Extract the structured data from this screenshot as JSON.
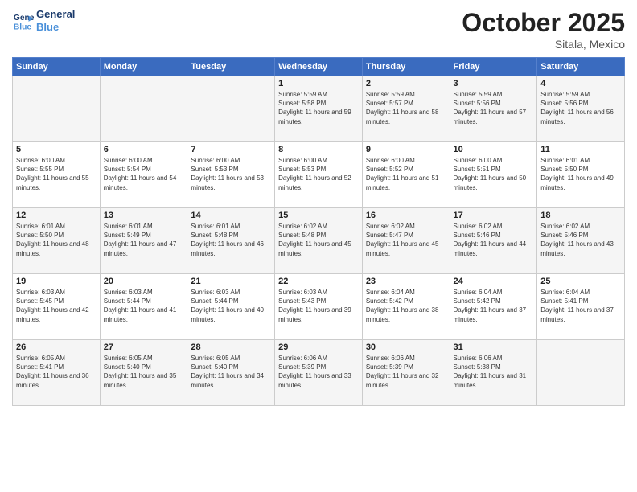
{
  "header": {
    "logo_line1": "General",
    "logo_line2": "Blue",
    "month": "October 2025",
    "location": "Sitala, Mexico"
  },
  "weekdays": [
    "Sunday",
    "Monday",
    "Tuesday",
    "Wednesday",
    "Thursday",
    "Friday",
    "Saturday"
  ],
  "weeks": [
    [
      {
        "day": "",
        "info": ""
      },
      {
        "day": "",
        "info": ""
      },
      {
        "day": "",
        "info": ""
      },
      {
        "day": "1",
        "info": "Sunrise: 5:59 AM\nSunset: 5:58 PM\nDaylight: 11 hours and 59 minutes."
      },
      {
        "day": "2",
        "info": "Sunrise: 5:59 AM\nSunset: 5:57 PM\nDaylight: 11 hours and 58 minutes."
      },
      {
        "day": "3",
        "info": "Sunrise: 5:59 AM\nSunset: 5:56 PM\nDaylight: 11 hours and 57 minutes."
      },
      {
        "day": "4",
        "info": "Sunrise: 5:59 AM\nSunset: 5:56 PM\nDaylight: 11 hours and 56 minutes."
      }
    ],
    [
      {
        "day": "5",
        "info": "Sunrise: 6:00 AM\nSunset: 5:55 PM\nDaylight: 11 hours and 55 minutes."
      },
      {
        "day": "6",
        "info": "Sunrise: 6:00 AM\nSunset: 5:54 PM\nDaylight: 11 hours and 54 minutes."
      },
      {
        "day": "7",
        "info": "Sunrise: 6:00 AM\nSunset: 5:53 PM\nDaylight: 11 hours and 53 minutes."
      },
      {
        "day": "8",
        "info": "Sunrise: 6:00 AM\nSunset: 5:53 PM\nDaylight: 11 hours and 52 minutes."
      },
      {
        "day": "9",
        "info": "Sunrise: 6:00 AM\nSunset: 5:52 PM\nDaylight: 11 hours and 51 minutes."
      },
      {
        "day": "10",
        "info": "Sunrise: 6:00 AM\nSunset: 5:51 PM\nDaylight: 11 hours and 50 minutes."
      },
      {
        "day": "11",
        "info": "Sunrise: 6:01 AM\nSunset: 5:50 PM\nDaylight: 11 hours and 49 minutes."
      }
    ],
    [
      {
        "day": "12",
        "info": "Sunrise: 6:01 AM\nSunset: 5:50 PM\nDaylight: 11 hours and 48 minutes."
      },
      {
        "day": "13",
        "info": "Sunrise: 6:01 AM\nSunset: 5:49 PM\nDaylight: 11 hours and 47 minutes."
      },
      {
        "day": "14",
        "info": "Sunrise: 6:01 AM\nSunset: 5:48 PM\nDaylight: 11 hours and 46 minutes."
      },
      {
        "day": "15",
        "info": "Sunrise: 6:02 AM\nSunset: 5:48 PM\nDaylight: 11 hours and 45 minutes."
      },
      {
        "day": "16",
        "info": "Sunrise: 6:02 AM\nSunset: 5:47 PM\nDaylight: 11 hours and 45 minutes."
      },
      {
        "day": "17",
        "info": "Sunrise: 6:02 AM\nSunset: 5:46 PM\nDaylight: 11 hours and 44 minutes."
      },
      {
        "day": "18",
        "info": "Sunrise: 6:02 AM\nSunset: 5:46 PM\nDaylight: 11 hours and 43 minutes."
      }
    ],
    [
      {
        "day": "19",
        "info": "Sunrise: 6:03 AM\nSunset: 5:45 PM\nDaylight: 11 hours and 42 minutes."
      },
      {
        "day": "20",
        "info": "Sunrise: 6:03 AM\nSunset: 5:44 PM\nDaylight: 11 hours and 41 minutes."
      },
      {
        "day": "21",
        "info": "Sunrise: 6:03 AM\nSunset: 5:44 PM\nDaylight: 11 hours and 40 minutes."
      },
      {
        "day": "22",
        "info": "Sunrise: 6:03 AM\nSunset: 5:43 PM\nDaylight: 11 hours and 39 minutes."
      },
      {
        "day": "23",
        "info": "Sunrise: 6:04 AM\nSunset: 5:42 PM\nDaylight: 11 hours and 38 minutes."
      },
      {
        "day": "24",
        "info": "Sunrise: 6:04 AM\nSunset: 5:42 PM\nDaylight: 11 hours and 37 minutes."
      },
      {
        "day": "25",
        "info": "Sunrise: 6:04 AM\nSunset: 5:41 PM\nDaylight: 11 hours and 37 minutes."
      }
    ],
    [
      {
        "day": "26",
        "info": "Sunrise: 6:05 AM\nSunset: 5:41 PM\nDaylight: 11 hours and 36 minutes."
      },
      {
        "day": "27",
        "info": "Sunrise: 6:05 AM\nSunset: 5:40 PM\nDaylight: 11 hours and 35 minutes."
      },
      {
        "day": "28",
        "info": "Sunrise: 6:05 AM\nSunset: 5:40 PM\nDaylight: 11 hours and 34 minutes."
      },
      {
        "day": "29",
        "info": "Sunrise: 6:06 AM\nSunset: 5:39 PM\nDaylight: 11 hours and 33 minutes."
      },
      {
        "day": "30",
        "info": "Sunrise: 6:06 AM\nSunset: 5:39 PM\nDaylight: 11 hours and 32 minutes."
      },
      {
        "day": "31",
        "info": "Sunrise: 6:06 AM\nSunset: 5:38 PM\nDaylight: 11 hours and 31 minutes."
      },
      {
        "day": "",
        "info": ""
      }
    ]
  ]
}
